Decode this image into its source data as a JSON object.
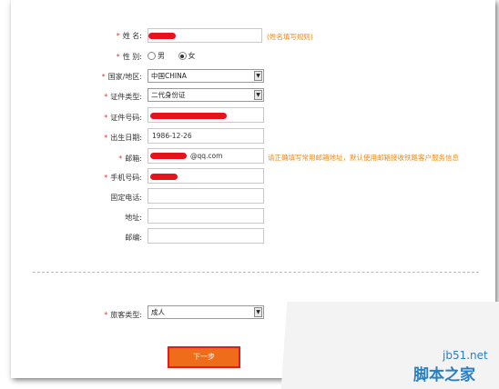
{
  "form": {
    "name": {
      "label": "姓 名:",
      "required": true,
      "hint": "(姓名填写规则)"
    },
    "gender": {
      "label": "性 别:",
      "required": true,
      "options": [
        {
          "label": "男",
          "checked": false
        },
        {
          "label": "女",
          "checked": true
        }
      ]
    },
    "country": {
      "label": "国家/地区:",
      "required": true,
      "value": "中国CHINA"
    },
    "id_type": {
      "label": "证件类型:",
      "required": true,
      "value": "二代身份证"
    },
    "id_number": {
      "label": "证件号码:",
      "required": true
    },
    "birth": {
      "label": "出生日期:",
      "required": true,
      "value": "1986-12-26"
    },
    "email": {
      "label": "邮箱:",
      "required": true,
      "value_suffix": "@qq.com",
      "hint": "请正确填写常用邮箱地址，默认使用邮箱接收铁路客户服务信息"
    },
    "mobile": {
      "label": "手机号码:",
      "required": true
    },
    "phone": {
      "label": "固定电话:"
    },
    "address": {
      "label": "地址:"
    },
    "zip": {
      "label": "邮编:"
    },
    "passenger_type": {
      "label": "旅客类型:",
      "required": true,
      "value": "成人"
    }
  },
  "buttons": {
    "next": "下一步"
  },
  "watermark": {
    "site": "jb51.net",
    "name": "脚本之家"
  },
  "colors": {
    "required_star": "#e33333",
    "hint": "#f08a1b",
    "button": "#ef6c1b",
    "redaction": "#e8121a"
  },
  "icons": {
    "dropdown": "chevron-down-icon"
  }
}
